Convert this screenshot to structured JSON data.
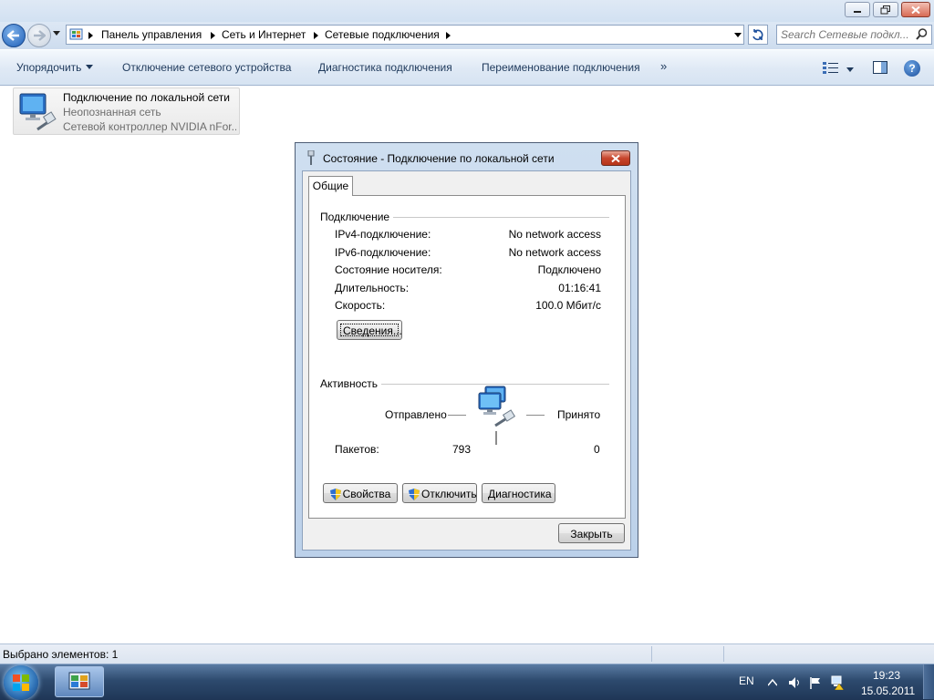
{
  "explorer": {
    "address": {
      "crumbs": [
        "Панель управления",
        "Сеть и Интернет",
        "Сетевые подключения"
      ]
    },
    "search": {
      "placeholder": "Search Сетевые подкл..."
    },
    "toolbar": {
      "organize": "Упорядочить",
      "disable_device": "Отключение сетевого устройства",
      "diagnose": "Диагностика подключения",
      "rename": "Переименование подключения",
      "more": "»"
    },
    "item": {
      "name": "Подключение по локальной сети",
      "status": "Неопознанная сеть",
      "device": "Сетевой контроллер NVIDIA nFor..."
    },
    "statusbar": {
      "text": "Выбрано элементов: 1"
    }
  },
  "dialog": {
    "title": "Состояние - Подключение по локальной сети",
    "tab": "Общие",
    "connection": {
      "heading": "Подключение",
      "rows": [
        {
          "label": "IPv4-подключение:",
          "value": "No network access"
        },
        {
          "label": "IPv6-подключение:",
          "value": "No network access"
        },
        {
          "label": "Состояние носителя:",
          "value": "Подключено"
        },
        {
          "label": "Длительность:",
          "value": "01:16:41"
        },
        {
          "label": "Скорость:",
          "value": "100.0 Мбит/с"
        }
      ],
      "details_button": "Сведения..."
    },
    "activity": {
      "heading": "Активность",
      "sent_label": "Отправлено",
      "received_label": "Принято",
      "packets_label": "Пакетов:",
      "packets_sent": "793",
      "packets_received": "0"
    },
    "buttons": {
      "properties": "Свойства",
      "disable": "Отключить",
      "diagnose": "Диагностика",
      "close": "Закрыть"
    }
  },
  "taskbar": {
    "language": "EN",
    "time": "19:23",
    "date": "15.05.2011"
  },
  "colors": {
    "taskbar": "#2d4a6e",
    "accent": "#1c4f9c",
    "close_red": "#c7462d"
  }
}
